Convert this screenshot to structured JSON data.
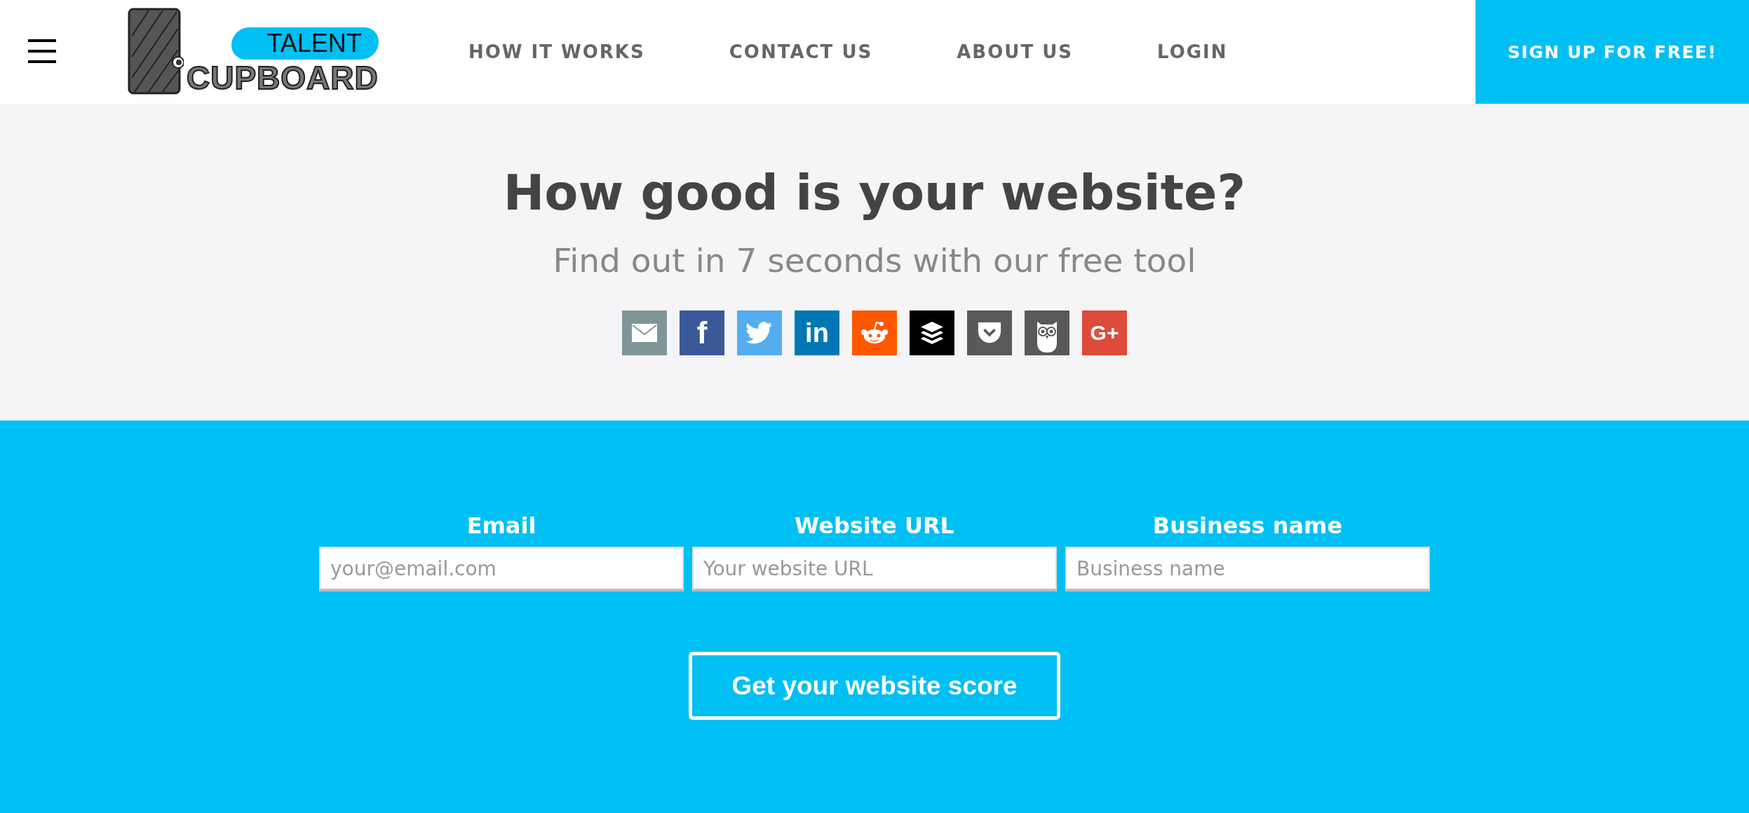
{
  "header": {
    "logo": {
      "top": "TALENT",
      "bottom": "CUPBOARD"
    },
    "nav": [
      {
        "label": "HOW IT WORKS"
      },
      {
        "label": "CONTACT US"
      },
      {
        "label": "ABOUT US"
      },
      {
        "label": "LOGIN"
      }
    ],
    "cta": "SIGN UP FOR FREE!"
  },
  "hero": {
    "title": "How good is your website?",
    "subtitle": "Find out in 7 seconds with our free tool",
    "share": [
      {
        "kind": "email",
        "color": "#7f9699"
      },
      {
        "kind": "facebook",
        "color": "#3b5998",
        "label": "f"
      },
      {
        "kind": "twitter",
        "color": "#55acee"
      },
      {
        "kind": "linkedin",
        "color": "#0077b5",
        "label": "in"
      },
      {
        "kind": "reddit",
        "color": "#ff5700"
      },
      {
        "kind": "buffer",
        "color": "#000000"
      },
      {
        "kind": "pocket",
        "color": "#595959"
      },
      {
        "kind": "owl",
        "color": "#595959"
      },
      {
        "kind": "googleplus",
        "color": "#dd4b39",
        "label": "G+"
      }
    ]
  },
  "form": {
    "fields": [
      {
        "label": "Email",
        "placeholder": "your@email.com"
      },
      {
        "label": "Website URL",
        "placeholder": "Your website URL"
      },
      {
        "label": "Business name",
        "placeholder": "Business name"
      }
    ],
    "submit": "Get your website score"
  }
}
